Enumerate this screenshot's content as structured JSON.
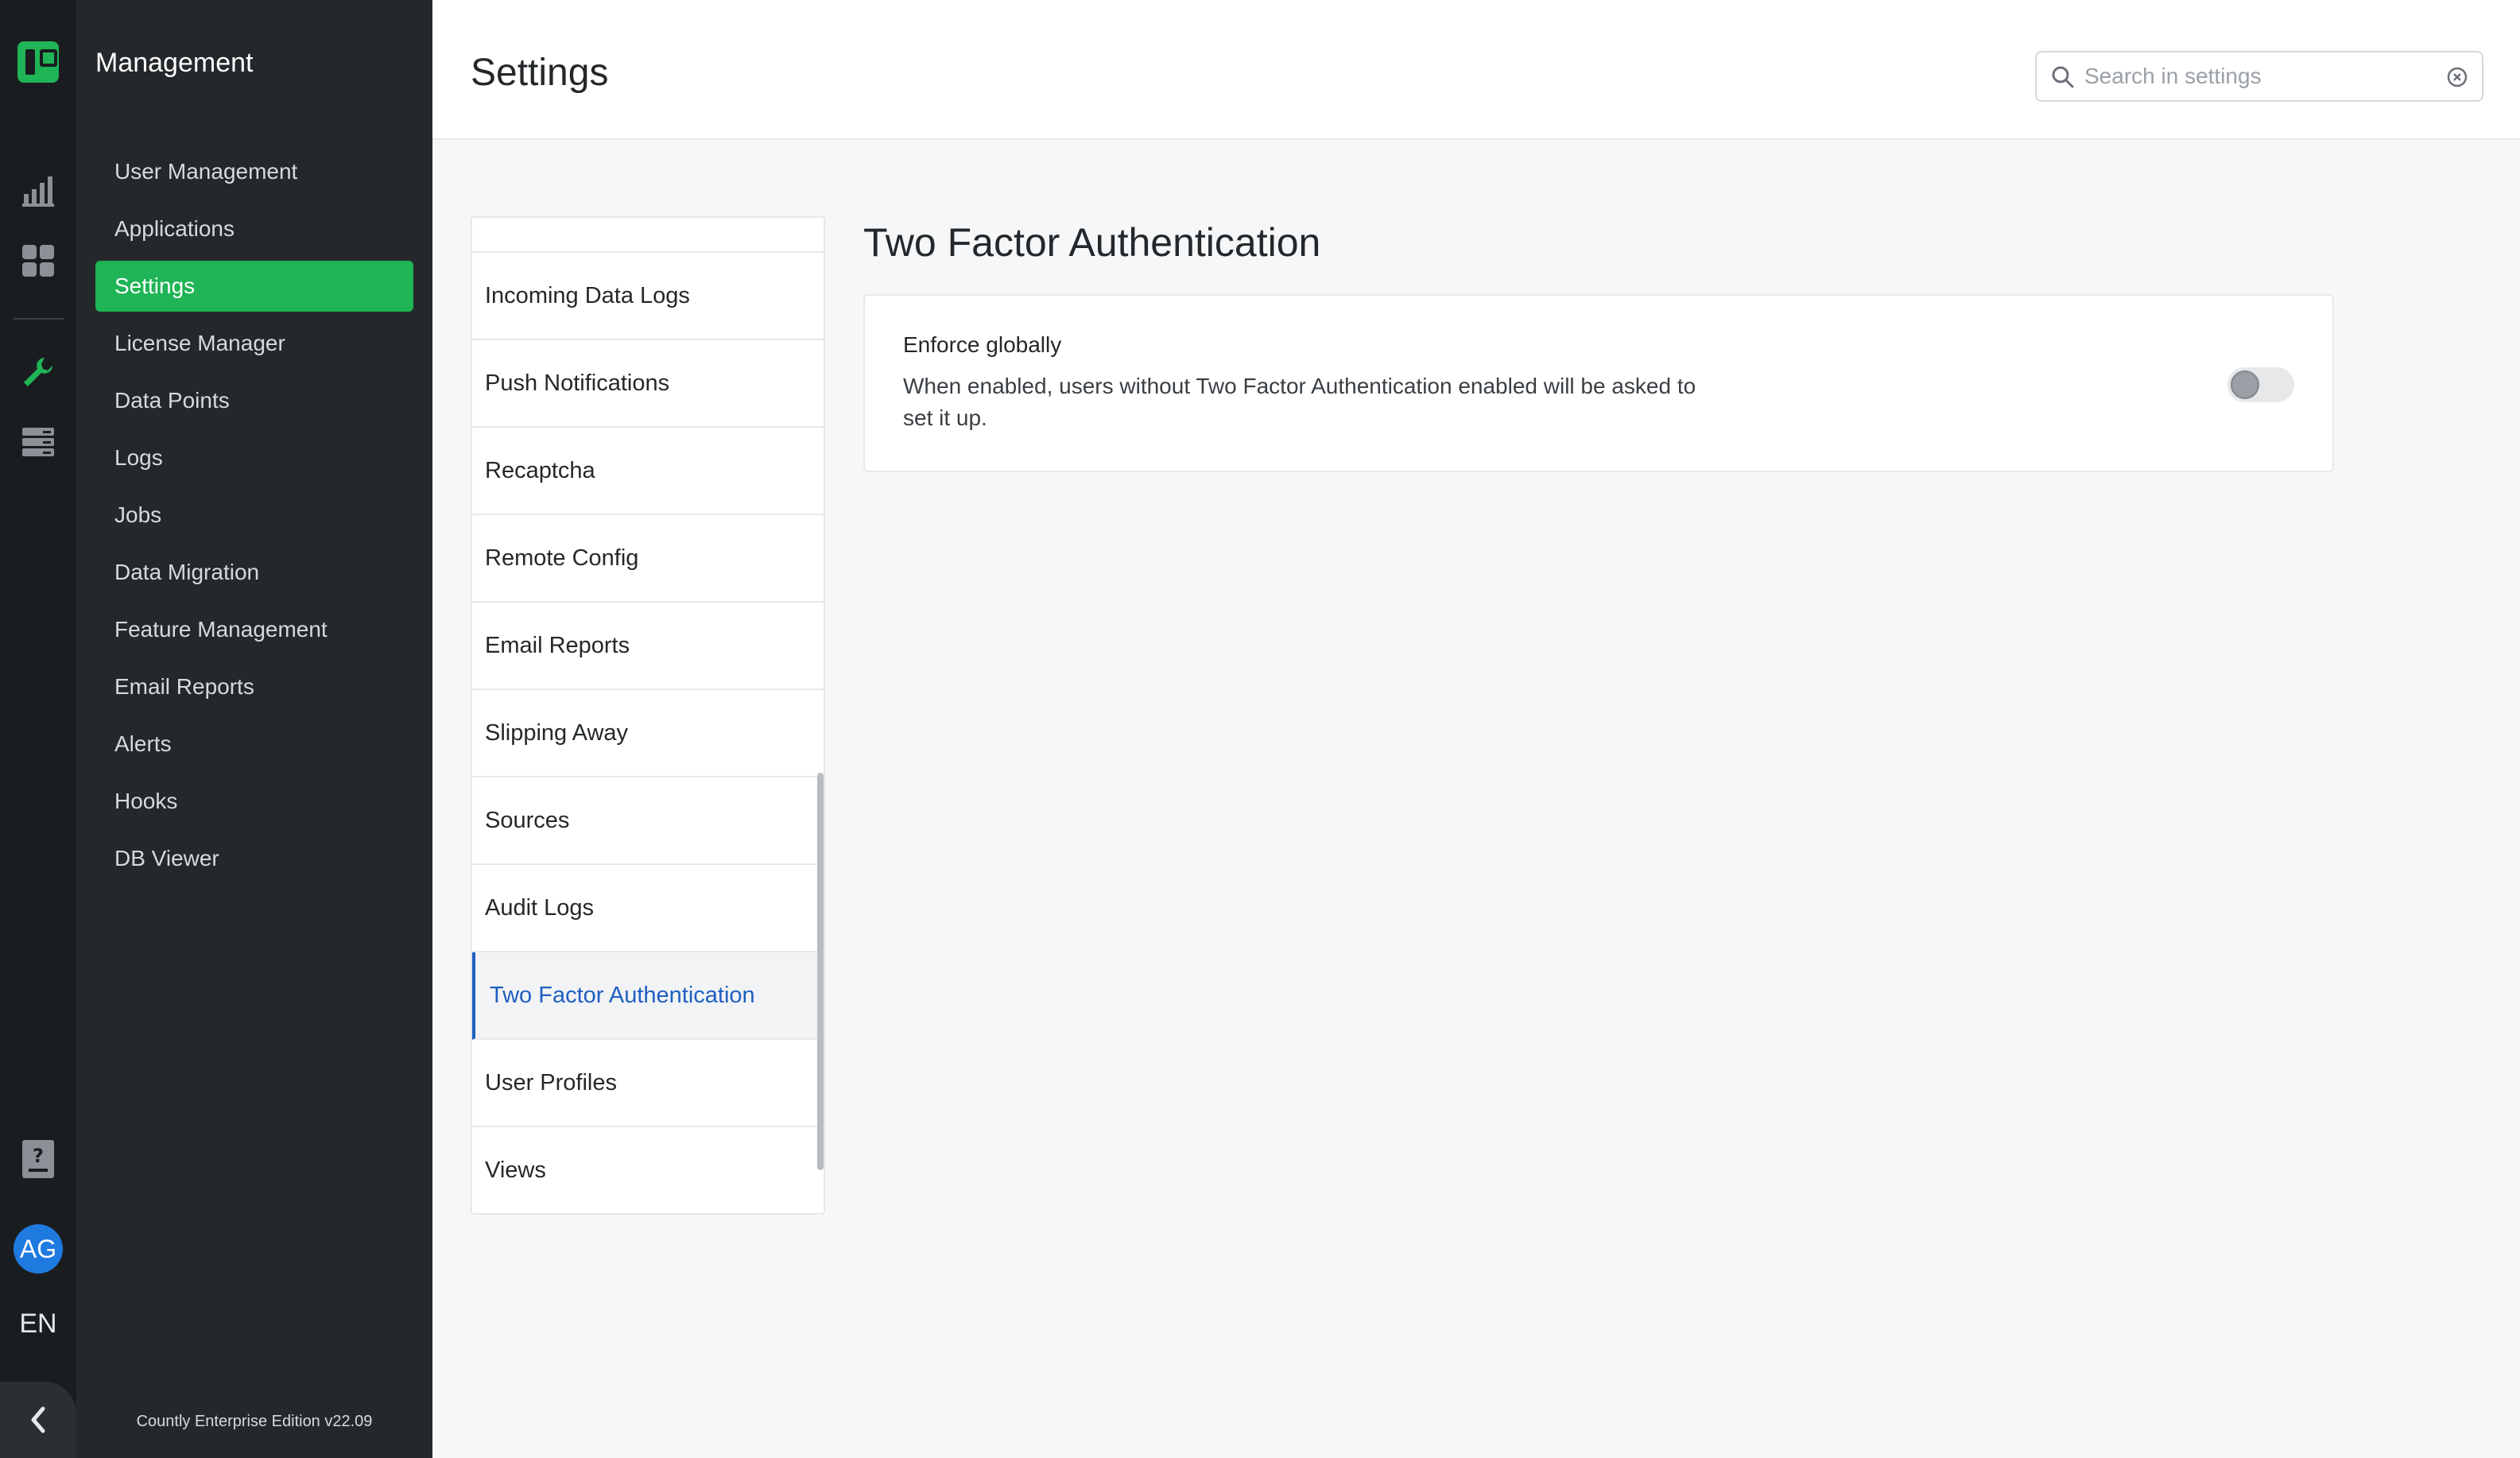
{
  "rail": {
    "logo_icon": "countly-logo-icon",
    "icons": [
      "analytics-bar-chart-icon",
      "dashboard-grid-icon",
      "wrench-icon",
      "server-stack-icon"
    ],
    "help_icon": "help-document-icon",
    "avatar_initials": "AG",
    "language": "EN",
    "collapse_icon": "chevron-left-icon"
  },
  "sidebar": {
    "title": "Management",
    "items": [
      {
        "label": "User Management"
      },
      {
        "label": "Applications"
      },
      {
        "label": "Settings",
        "active": true
      },
      {
        "label": "License Manager"
      },
      {
        "label": "Data Points"
      },
      {
        "label": "Logs"
      },
      {
        "label": "Jobs"
      },
      {
        "label": "Data Migration"
      },
      {
        "label": "Feature Management"
      },
      {
        "label": "Email Reports"
      },
      {
        "label": "Alerts"
      },
      {
        "label": "Hooks"
      },
      {
        "label": "DB Viewer"
      }
    ],
    "edition": "Countly Enterprise Edition v22.09"
  },
  "header": {
    "title": "Settings",
    "search": {
      "placeholder": "Search in settings",
      "value": ""
    }
  },
  "settings_list": {
    "items": [
      {
        "label": "Incoming Data Logs"
      },
      {
        "label": "Push Notifications"
      },
      {
        "label": "Recaptcha"
      },
      {
        "label": "Remote Config"
      },
      {
        "label": "Email Reports"
      },
      {
        "label": "Slipping Away"
      },
      {
        "label": "Sources"
      },
      {
        "label": "Audit Logs"
      },
      {
        "label": "Two Factor Authentication",
        "active": true
      },
      {
        "label": "User Profiles"
      },
      {
        "label": "Views"
      }
    ]
  },
  "detail": {
    "title": "Two Factor Authentication",
    "setting": {
      "label": "Enforce globally",
      "description": "When enabled, users without Two Factor Authentication enabled will be asked to set it up.",
      "enabled": false
    }
  },
  "colors": {
    "accent": "#1fb455",
    "active_link": "#1f5fc2",
    "rail_bg": "#1a1d20",
    "sidebar_bg": "#24282b",
    "avatar": "#1f7ae0"
  }
}
